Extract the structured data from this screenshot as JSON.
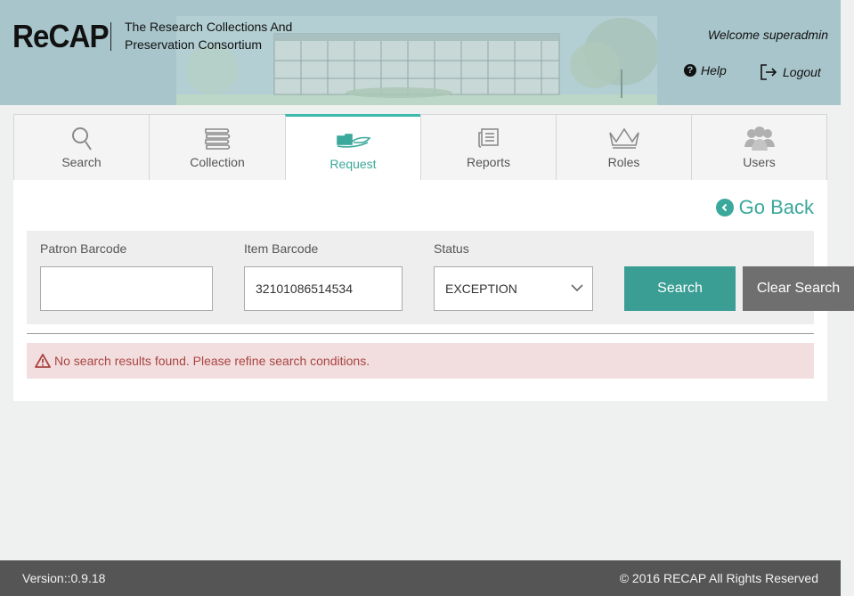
{
  "header": {
    "logo": "ReCAP",
    "tagline_line1": "The Research Collections And",
    "tagline_line2": "Preservation Consortium",
    "welcome": "Welcome superadmin",
    "help_label": "Help",
    "logout_label": "Logout"
  },
  "tabs": [
    {
      "label": "Search",
      "icon": "search-icon"
    },
    {
      "label": "Collection",
      "icon": "books-icon"
    },
    {
      "label": "Request",
      "icon": "hand-book-icon",
      "active": true
    },
    {
      "label": "Reports",
      "icon": "report-icon"
    },
    {
      "label": "Roles",
      "icon": "crown-icon"
    },
    {
      "label": "Users",
      "icon": "users-icon"
    }
  ],
  "panel": {
    "go_back_label": "Go Back",
    "filters": {
      "patron_barcode_label": "Patron Barcode",
      "patron_barcode_value": "",
      "item_barcode_label": "Item Barcode",
      "item_barcode_value": "32101086514534",
      "status_label": "Status",
      "status_value": "EXCEPTION"
    },
    "search_button": "Search",
    "clear_button": "Clear Search",
    "alert_message": "No search results found. Please refine search conditions."
  },
  "footer": {
    "version": "Version::0.9.18",
    "copyright": "© 2016 RECAP All Rights Reserved"
  },
  "colors": {
    "header_bg": "#a8c5cb",
    "accent": "#3a9e94",
    "clear_button": "#6f6f6f",
    "alert_bg": "#f2dede",
    "alert_text": "#a94442",
    "footer_bg": "#555555"
  }
}
